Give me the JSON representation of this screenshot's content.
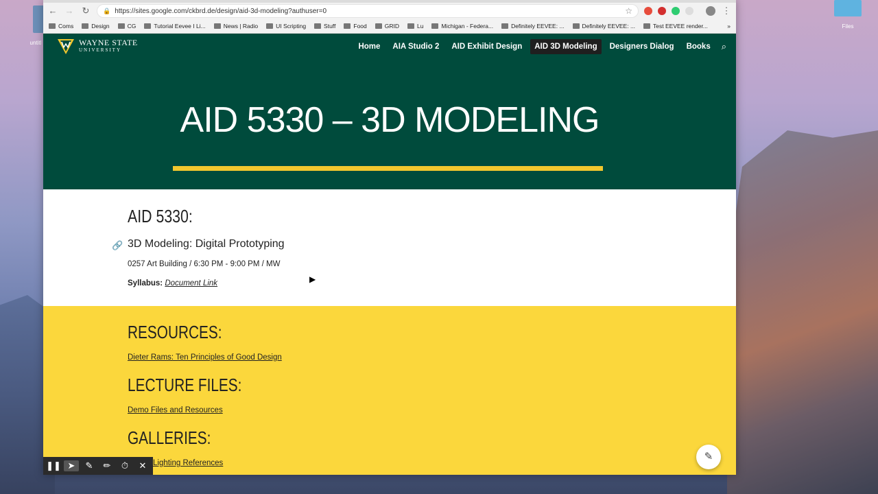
{
  "browser": {
    "url": "https://sites.google.com/ckbrd.de/design/aid-3d-modeling?authuser=0",
    "bookmarks": [
      "Coms",
      "Design",
      "CG",
      "Tutorial Eevee I Li...",
      "News | Radio",
      "UI Scripting",
      "Stuff",
      "Food",
      "GRID",
      "Lu",
      "Michigan - Federa...",
      "Definitely EEVEE: ...",
      "Definitely EEVEE: ...",
      "Test EEVEE render..."
    ],
    "more": "»"
  },
  "desktop": {
    "left_label": "untitl",
    "right_label": "Files"
  },
  "site": {
    "logo_line1": "WAYNE STATE",
    "logo_line2": "UNIVERSITY",
    "nav": [
      "Home",
      "AIA Studio 2",
      "AID Exhibit Design",
      "AID 3D Modeling",
      "Designers Dialog",
      "Books"
    ],
    "active_nav": "AID 3D Modeling",
    "hero_title": "AID 5330 – 3D MODELING",
    "colors": {
      "header": "#004b3c",
      "accent": "#f2c72e",
      "band": "#fbd73c"
    }
  },
  "content": {
    "course_code": "AID 5330:",
    "course_name": "3D Modeling: Digital Prototyping",
    "schedule": "0257 Art Building / 6:30 PM - 9:00 PM / MW",
    "syllabus_label": "Syllabus:",
    "syllabus_link": "Document Link",
    "resources_heading": "RESOURCES:",
    "resources_link": "Dieter Rams: Ten Principles of Good Design",
    "lecture_heading": "LECTURE FILES:",
    "lecture_link": "Demo Files and Resources",
    "galleries_heading": "GALLERIES:",
    "galleries_link": "Lighting References"
  }
}
